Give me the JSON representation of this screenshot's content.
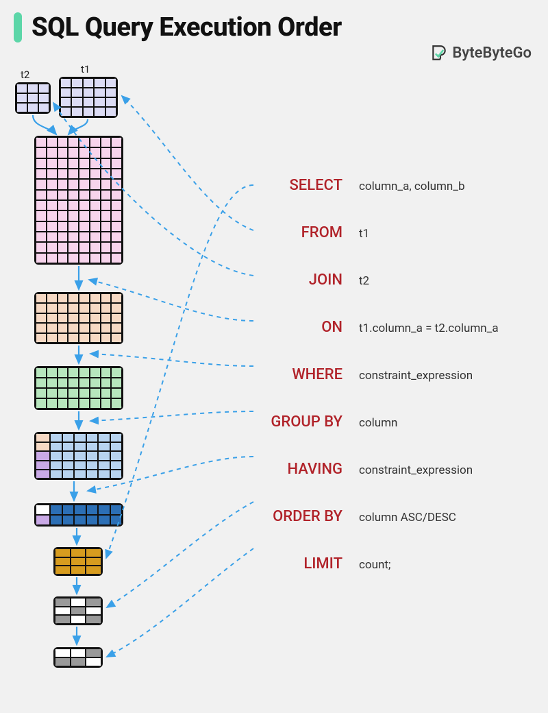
{
  "title": "SQL Query Execution Order",
  "brand": "ByteByteGo",
  "tables": {
    "t1": "t1",
    "t2": "t2"
  },
  "clauses": [
    {
      "keyword": "SELECT",
      "arg": "column_a, column_b"
    },
    {
      "keyword": "FROM",
      "arg": "t1"
    },
    {
      "keyword": "JOIN",
      "arg": "t2"
    },
    {
      "keyword": "ON",
      "arg": "t1.column_a = t2.column_a"
    },
    {
      "keyword": "WHERE",
      "arg": "constraint_expression"
    },
    {
      "keyword": "GROUP BY",
      "arg": "column"
    },
    {
      "keyword": "HAVING",
      "arg": "constraint_expression"
    },
    {
      "keyword": "ORDER BY",
      "arg": "column ASC/DESC"
    },
    {
      "keyword": "LIMIT",
      "arg": "count;"
    }
  ],
  "colors": {
    "accent": "#5cd6a8",
    "keyword": "#b1232a",
    "arrow": "#3aa0e8",
    "t_lavender": "#dcdcf5",
    "t_pink": "#f7d4ec",
    "t_peach": "#f6d9c4",
    "t_green": "#b7e6bd",
    "t_blue_light": "#b7d3ef",
    "t_blue_dark": "#2c6fb5",
    "t_purple": "#c9a9e6",
    "t_gold": "#d79c1f",
    "t_gray": "#9a9a9a"
  }
}
